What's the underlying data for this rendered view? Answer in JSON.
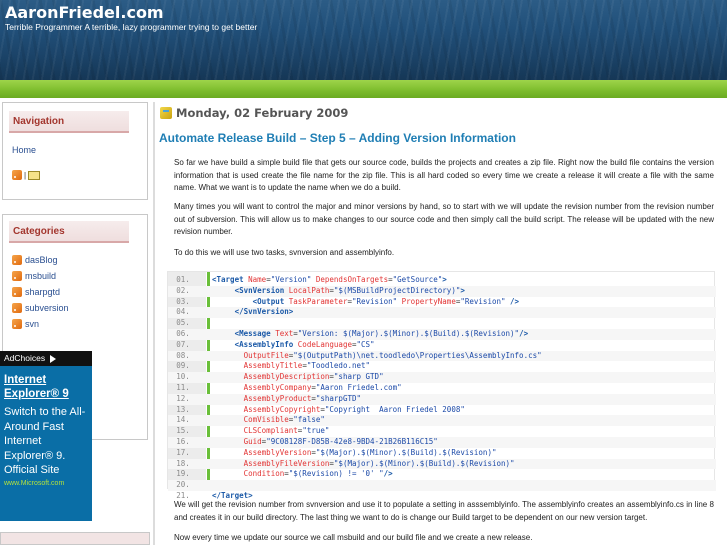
{
  "header": {
    "title": "AaronFriedel.com",
    "tagline": "Terrible Programmer A terrible, lazy programmer trying to get better"
  },
  "sidebar": {
    "navigation": {
      "title": "Navigation",
      "home": "Home",
      "separator": "|"
    },
    "categories": {
      "title": "Categories",
      "items": [
        "dasBlog",
        "msbuild",
        "sharpgtd",
        "subversion",
        "svn"
      ]
    },
    "ad": {
      "choices": "AdChoices",
      "title": "Internet Explorer® 9",
      "body": "Switch to the All-Around Fast Internet Explorer® 9. Official Site",
      "url": "www.Microsoft.com"
    }
  },
  "post": {
    "date": "Monday, 02 February 2009",
    "title": "Automate Release Build – Step 5 – Adding Version Information",
    "para1": "So far we have build a simple build file that gets our source code, builds the projects and creates a zip file.  Right now the build file contains the version information that is used create the file name for the zip file.  This is all hard coded so every time we create a release it will create a file with the same name.  What we want is to update the name when we do a build.",
    "para2": "Many times you will want to control the major and minor versions by hand, so to start with we will update the revision number from the revision number out of subversion.  This will allow us to make changes to our source code and then simply call the build script.  The release will be updated with the new revision number.",
    "para3": "To do this we will use two tasks, svnversion and assemblyinfo.",
    "para4": "We will get the revision number from svnversion and use it to populate a setting in asssemblyinfo. The assemblyinfo creates an assemblyinfo.cs in line 8 and creates it in our build directory.  The last thing we want to do is change our Build target to be dependent on our new version target.",
    "para5": "Now every time we update our source we call msbuild and our build file and we create a new release."
  },
  "code": {
    "line_numbers": [
      "01.",
      "02.",
      "03.",
      "04.",
      "05.",
      "06.",
      "07.",
      "08.",
      "09.",
      "10.",
      "11.",
      "12.",
      "13.",
      "14.",
      "15.",
      "16.",
      "17.",
      "18.",
      "19.",
      "20.",
      "21."
    ],
    "lines": [
      [
        [
          "t",
          "<Target "
        ],
        [
          "a",
          "Name"
        ],
        [
          "p",
          "="
        ],
        [
          "v",
          "\"Version\" "
        ],
        [
          "a",
          "DependsOnTargets"
        ],
        [
          "p",
          "="
        ],
        [
          "v",
          "\"GetSource\""
        ],
        [
          "t",
          ">"
        ]
      ],
      [
        [
          "p",
          "     "
        ],
        [
          "t",
          "<SvnVersion "
        ],
        [
          "a",
          "LocalPath"
        ],
        [
          "p",
          "="
        ],
        [
          "v",
          "\"$(MSBuildProjectDirectory)\""
        ],
        [
          "t",
          ">"
        ]
      ],
      [
        [
          "p",
          "         "
        ],
        [
          "t",
          "<Output "
        ],
        [
          "a",
          "TaskParameter"
        ],
        [
          "p",
          "="
        ],
        [
          "v",
          "\"Revision\" "
        ],
        [
          "a",
          "PropertyName"
        ],
        [
          "p",
          "="
        ],
        [
          "v",
          "\"Revision\" "
        ],
        [
          "t",
          "/>"
        ]
      ],
      [
        [
          "p",
          "     "
        ],
        [
          "t",
          "</SvnVersion>"
        ]
      ],
      [
        [
          "p",
          ""
        ]
      ],
      [
        [
          "p",
          "     "
        ],
        [
          "t",
          "<Message "
        ],
        [
          "a",
          "Text"
        ],
        [
          "p",
          "="
        ],
        [
          "v",
          "\"Version: $(Major).$(Minor).$(Build).$(Revision)\""
        ],
        [
          "t",
          "/>"
        ]
      ],
      [
        [
          "p",
          "     "
        ],
        [
          "t",
          "<AssemblyInfo "
        ],
        [
          "a",
          "CodeLanguage"
        ],
        [
          "p",
          "="
        ],
        [
          "v",
          "\"CS\""
        ]
      ],
      [
        [
          "p",
          "       "
        ],
        [
          "a",
          "OutputFile"
        ],
        [
          "p",
          "="
        ],
        [
          "v",
          "\"$(OutputPath)\\net.toodledo\\Properties\\AssemblyInfo.cs\""
        ]
      ],
      [
        [
          "p",
          "       "
        ],
        [
          "a",
          "AssemblyTitle"
        ],
        [
          "p",
          "="
        ],
        [
          "v",
          "\"Toodledo.net\""
        ]
      ],
      [
        [
          "p",
          "       "
        ],
        [
          "a",
          "AssemblyDescription"
        ],
        [
          "p",
          "="
        ],
        [
          "v",
          "\"sharp GTD\""
        ]
      ],
      [
        [
          "p",
          "       "
        ],
        [
          "a",
          "AssemblyCompany"
        ],
        [
          "p",
          "="
        ],
        [
          "v",
          "\"Aaron Friedel.com\""
        ]
      ],
      [
        [
          "p",
          "       "
        ],
        [
          "a",
          "AssemblyProduct"
        ],
        [
          "p",
          "="
        ],
        [
          "v",
          "\"sharpGTD\""
        ]
      ],
      [
        [
          "p",
          "       "
        ],
        [
          "a",
          "AssemblyCopyright"
        ],
        [
          "p",
          "="
        ],
        [
          "v",
          "\"Copyright  Aaron Friedel 2008\""
        ]
      ],
      [
        [
          "p",
          "       "
        ],
        [
          "a",
          "ComVisible"
        ],
        [
          "p",
          "="
        ],
        [
          "v",
          "\"false\""
        ]
      ],
      [
        [
          "p",
          "       "
        ],
        [
          "a",
          "CLSCompliant"
        ],
        [
          "p",
          "="
        ],
        [
          "v",
          "\"true\""
        ]
      ],
      [
        [
          "p",
          "       "
        ],
        [
          "a",
          "Guid"
        ],
        [
          "p",
          "="
        ],
        [
          "v",
          "\"9C08128F-D85B-42e8-9BD4-21B26B116C15\""
        ]
      ],
      [
        [
          "p",
          "       "
        ],
        [
          "a",
          "AssemblyVersion"
        ],
        [
          "p",
          "="
        ],
        [
          "v",
          "\"$(Major).$(Minor).$(Build).$(Revision)\""
        ]
      ],
      [
        [
          "p",
          "       "
        ],
        [
          "a",
          "AssemblyFileVersion"
        ],
        [
          "p",
          "="
        ],
        [
          "v",
          "\"$(Major).$(Minor).$(Build).$(Revision)\""
        ]
      ],
      [
        [
          "p",
          "       "
        ],
        [
          "a",
          "Condition"
        ],
        [
          "p",
          "="
        ],
        [
          "v",
          "\"$(Revision) != '0' \""
        ],
        [
          "t",
          "/>"
        ]
      ],
      [
        [
          "p",
          ""
        ]
      ],
      [
        [
          "t",
          "</Target>"
        ]
      ]
    ]
  }
}
